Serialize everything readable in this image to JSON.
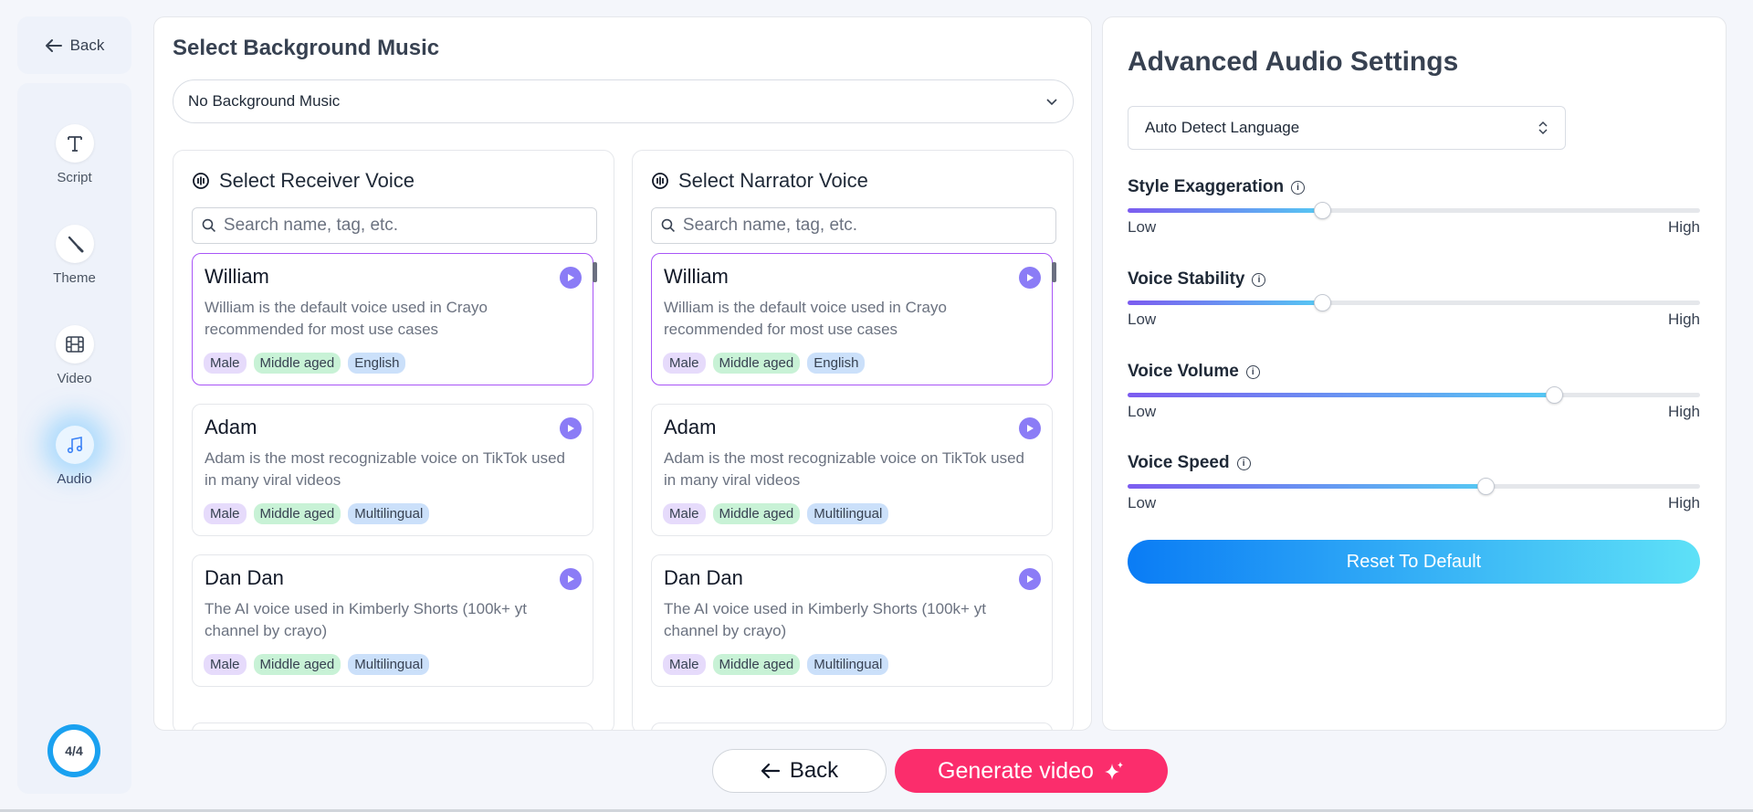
{
  "nav": {
    "back_label": "Back",
    "items": [
      {
        "label": "Script",
        "icon": "text-icon"
      },
      {
        "label": "Theme",
        "icon": "brush-icon"
      },
      {
        "label": "Video",
        "icon": "film-icon"
      },
      {
        "label": "Audio",
        "icon": "music-icon",
        "active": true
      }
    ],
    "progress": "4/4"
  },
  "music": {
    "title": "Select Background Music",
    "selected": "No Background Music"
  },
  "receiver": {
    "title": "Select Receiver Voice",
    "search_placeholder": "Search name, tag, etc.",
    "voices": [
      {
        "name": "William",
        "desc": "William is the default voice used in Crayo recommended for most use cases",
        "tags": [
          "Male",
          "Middle aged",
          "English"
        ]
      },
      {
        "name": "Adam",
        "desc": "Adam is the most recognizable voice on TikTok used in many viral videos",
        "tags": [
          "Male",
          "Middle aged",
          "Multilingual"
        ]
      },
      {
        "name": "Dan Dan",
        "desc": "The AI voice used in Kimberly Shorts (100k+ yt channel by crayo)",
        "tags": [
          "Male",
          "Middle aged",
          "Multilingual"
        ]
      }
    ]
  },
  "narrator": {
    "title": "Select Narrator Voice",
    "search_placeholder": "Search name, tag, etc.",
    "voices": [
      {
        "name": "William",
        "desc": "William is the default voice used in Crayo recommended for most use cases",
        "tags": [
          "Male",
          "Middle aged",
          "English"
        ]
      },
      {
        "name": "Adam",
        "desc": "Adam is the most recognizable voice on TikTok used in many viral videos",
        "tags": [
          "Male",
          "Middle aged",
          "Multilingual"
        ]
      },
      {
        "name": "Dan Dan",
        "desc": "The AI voice used in Kimberly Shorts (100k+ yt channel by crayo)",
        "tags": [
          "Male",
          "Middle aged",
          "Multilingual"
        ]
      }
    ]
  },
  "advanced": {
    "title": "Advanced Audio Settings",
    "language": "Auto Detect Language",
    "low_label": "Low",
    "high_label": "High",
    "sliders": [
      {
        "label": "Style Exaggeration",
        "value": 0.34
      },
      {
        "label": "Voice Stability",
        "value": 0.34
      },
      {
        "label": "Voice Volume",
        "value": 0.745
      },
      {
        "label": "Voice Speed",
        "value": 0.625
      }
    ],
    "reset_label": "Reset To Default"
  },
  "footer": {
    "back_label": "Back",
    "generate_label": "Generate video"
  },
  "colors": {
    "accent_purple": "#8b7cf6",
    "generate_pink": "#fb2d6c",
    "reset_blue": "#0a7cf5"
  }
}
